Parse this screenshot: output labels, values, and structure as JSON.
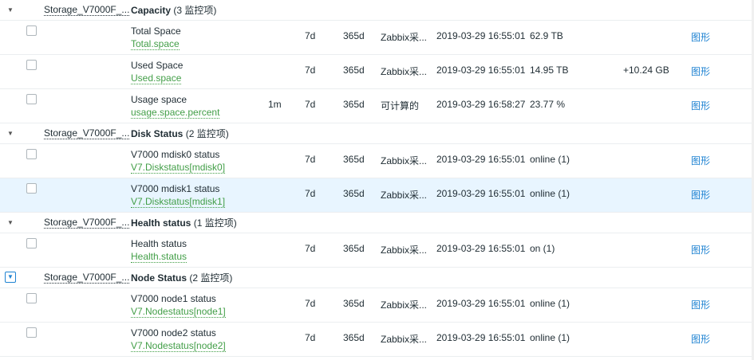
{
  "groups": [
    {
      "toggle": "▼",
      "host": "Storage_V7000F_...",
      "name": "Capacity",
      "count": " (3 监控项)",
      "items": [
        {
          "name": "Total Space",
          "key": "Total.space",
          "interval": "",
          "history": "7d",
          "trends": "365d",
          "type": "Zabbix采...",
          "last_check": "2019-03-29 16:55:01",
          "last_value": "62.9 TB",
          "change": "",
          "link": "图形"
        },
        {
          "name": "Used Space",
          "key": "Used.space",
          "interval": "",
          "history": "7d",
          "trends": "365d",
          "type": "Zabbix采...",
          "last_check": "2019-03-29 16:55:01",
          "last_value": "14.95 TB",
          "change": "+10.24 GB",
          "link": "图形"
        },
        {
          "name": "Usage space",
          "key": "usage.space.percent",
          "interval": "1m",
          "history": "7d",
          "trends": "365d",
          "type": "可计算的",
          "last_check": "2019-03-29 16:58:27",
          "last_value": "23.77 %",
          "change": "",
          "link": "图形"
        }
      ]
    },
    {
      "toggle": "▼",
      "host": "Storage_V7000F_...",
      "name": "Disk Status",
      "count": " (2 监控项)",
      "items": [
        {
          "name": "V7000 mdisk0 status",
          "key": "V7.Diskstatus[mdisk0]",
          "interval": "",
          "history": "7d",
          "trends": "365d",
          "type": "Zabbix采...",
          "last_check": "2019-03-29 16:55:01",
          "last_value": "online (1)",
          "change": "",
          "link": "图形"
        },
        {
          "name": "V7000 mdisk1 status",
          "key": "V7.Diskstatus[mdisk1]",
          "interval": "",
          "history": "7d",
          "trends": "365d",
          "type": "Zabbix采...",
          "last_check": "2019-03-29 16:55:01",
          "last_value": "online (1)",
          "change": "",
          "link": "图形",
          "highlighted": true
        }
      ]
    },
    {
      "toggle": "▼",
      "host": "Storage_V7000F_...",
      "name": "Health status",
      "count": " (1 监控项)",
      "items": [
        {
          "name": "Health status",
          "key": "Health.status",
          "interval": "",
          "history": "7d",
          "trends": "365d",
          "type": "Zabbix采...",
          "last_check": "2019-03-29 16:55:01",
          "last_value": "on (1)",
          "change": "",
          "link": "图形"
        }
      ]
    },
    {
      "toggle": "▼",
      "toggle_selected": true,
      "host": "Storage_V7000F_...",
      "name": "Node Status",
      "count": " (2 监控项)",
      "items": [
        {
          "name": "V7000 node1 status",
          "key": "V7.Nodestatus[node1]",
          "interval": "",
          "history": "7d",
          "trends": "365d",
          "type": "Zabbix采...",
          "last_check": "2019-03-29 16:55:01",
          "last_value": "online (1)",
          "change": "",
          "link": "图形"
        },
        {
          "name": "V7000 node2 status",
          "key": "V7.Nodestatus[node2]",
          "interval": "",
          "history": "7d",
          "trends": "365d",
          "type": "Zabbix采...",
          "last_check": "2019-03-29 16:55:01",
          "last_value": "online (1)",
          "change": "",
          "link": "图形"
        }
      ]
    }
  ],
  "colors": {
    "link": "#1f83d2",
    "item_key": "#429e47",
    "highlight_row": "#e8f5ff"
  }
}
